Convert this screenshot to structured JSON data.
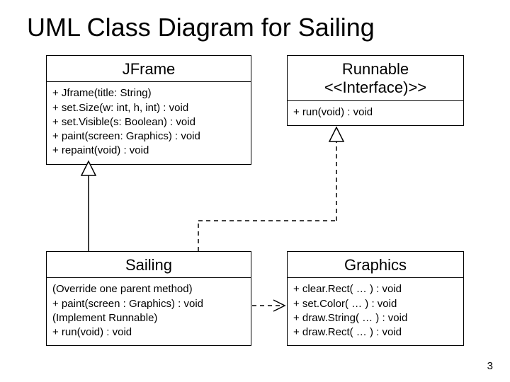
{
  "title": "UML Class Diagram for Sailing",
  "page_number": "3",
  "classes": {
    "jframe": {
      "name": "JFrame",
      "members": [
        "+ Jframe(title: String)",
        "+ set.Size(w: int, h, int) : void",
        "+ set.Visible(s: Boolean) : void",
        "+ paint(screen: Graphics) : void",
        "+ repaint(void) : void"
      ]
    },
    "runnable": {
      "name_line1": "Runnable",
      "name_line2": "<<Interface)>>",
      "members": [
        "+ run(void) : void"
      ]
    },
    "sailing": {
      "name": "Sailing",
      "members": [
        "(Override one parent method)",
        "+ paint(screen : Graphics) : void",
        "(Implement Runnable)",
        "+ run(void) : void"
      ]
    },
    "graphics": {
      "name": "Graphics",
      "members": [
        "+ clear.Rect( … ) : void",
        "+ set.Color( … ) : void",
        "+ draw.String( … ) : void",
        "+ draw.Rect( … ) : void"
      ]
    }
  }
}
